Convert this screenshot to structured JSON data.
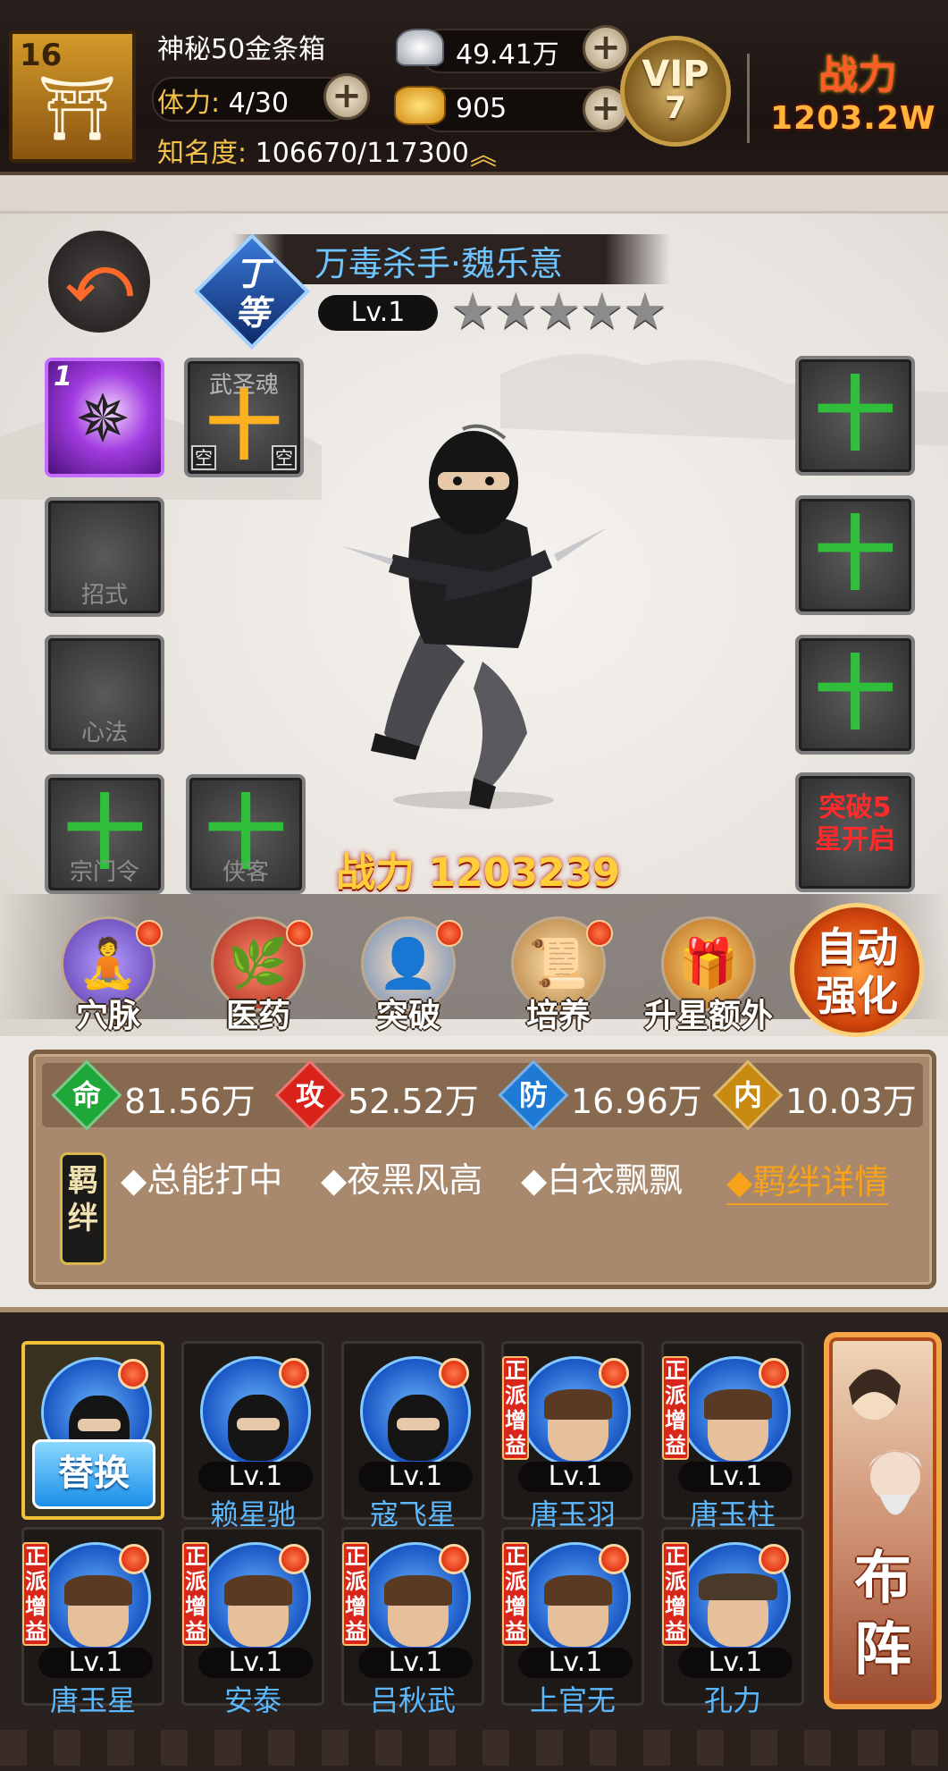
{
  "topbar": {
    "player_level": "16",
    "chest_title": "神秘50金条箱",
    "stamina_label": "体力:",
    "stamina_value": "4/30",
    "fame_label": "知名度:",
    "fame_value": "106670/117300",
    "silver_value": "49.41万",
    "gold_value": "905",
    "vip_label": "VIP",
    "vip_level": "7",
    "power_label": "战力",
    "power_value": "1203.2W",
    "plus_symbol": "+"
  },
  "hero": {
    "name": "万毒杀手·魏乐意",
    "grade": "丁等",
    "level": "Lv.1",
    "stars_total": 5,
    "stars_lit": 0,
    "battle_power_label": "战力",
    "battle_power_value": "1203239"
  },
  "slots": {
    "skill_level": "1",
    "soul_label": "武圣魂",
    "empty_mark": "空",
    "move_label": "招式",
    "mind_label": "心法",
    "sect_label": "宗门令",
    "hero_label": "侠客",
    "breakthrough_text": "突破5星开启",
    "plus": "十"
  },
  "tabs": [
    {
      "label": "穴脉",
      "icon": "meridian-icon"
    },
    {
      "label": "医药",
      "icon": "medicine-icon"
    },
    {
      "label": "突破",
      "icon": "breakthrough-icon"
    },
    {
      "label": "培养",
      "icon": "training-icon"
    },
    {
      "label": "升星额外",
      "icon": "star-up-icon"
    }
  ],
  "auto_strengthen": "自动强化",
  "stats": [
    {
      "char": "命",
      "value": "81.56万",
      "color": "#1fa83a"
    },
    {
      "char": "攻",
      "value": "52.52万",
      "color": "#d8221a"
    },
    {
      "char": "防",
      "value": "16.96万",
      "color": "#1f7ad6"
    },
    {
      "char": "内",
      "value": "10.03万",
      "color": "#c98a12"
    }
  ],
  "bonds": {
    "tag": "羁绊",
    "items": [
      "◆总能打中",
      "◆夜黑风高",
      "◆白衣飘飘"
    ],
    "details_link": "◆羁绊详情"
  },
  "roster": {
    "swap_label": "替换",
    "faction_tag": "正派增益",
    "formation_label": "布阵",
    "cards": [
      {
        "name": "",
        "level": "",
        "type": "ninja",
        "selected": true,
        "faction": false
      },
      {
        "name": "赖星驰",
        "level": "Lv.1",
        "type": "ninja",
        "faction": false
      },
      {
        "name": "寇飞星",
        "level": "Lv.1",
        "type": "ninja",
        "faction": false
      },
      {
        "name": "唐玉羽",
        "level": "Lv.1",
        "type": "boy",
        "faction": true
      },
      {
        "name": "唐玉柱",
        "level": "Lv.1",
        "type": "boy",
        "faction": true
      },
      {
        "name": "唐玉星",
        "level": "Lv.1",
        "type": "boy",
        "faction": true
      },
      {
        "name": "安泰",
        "level": "Lv.1",
        "type": "boy",
        "faction": true
      },
      {
        "name": "吕秋武",
        "level": "Lv.1",
        "type": "boy",
        "faction": true
      },
      {
        "name": "上官无",
        "level": "Lv.1",
        "type": "boy",
        "faction": true
      },
      {
        "name": "孔力",
        "level": "Lv.1",
        "type": "hat",
        "faction": true
      }
    ]
  }
}
